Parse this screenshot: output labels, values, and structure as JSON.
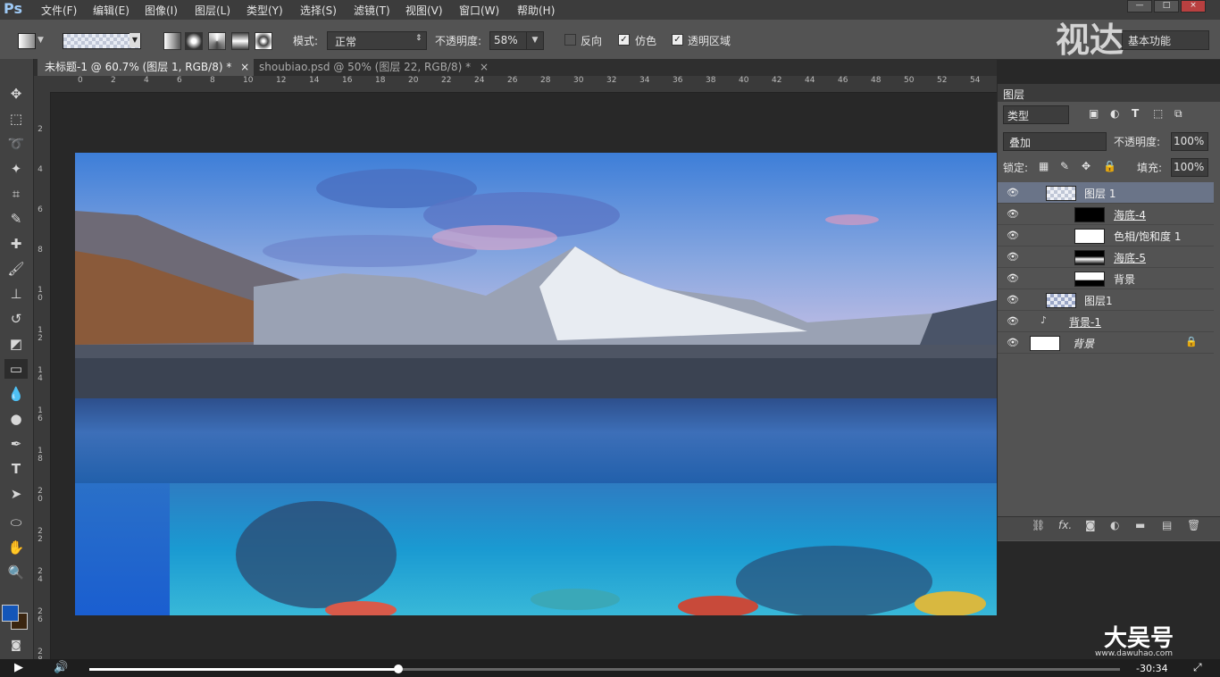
{
  "app": {
    "logo": "Ps"
  },
  "menu": [
    "文件(F)",
    "编辑(E)",
    "图像(I)",
    "图层(L)",
    "类型(Y)",
    "选择(S)",
    "滤镜(T)",
    "视图(V)",
    "窗口(W)",
    "帮助(H)"
  ],
  "window": {
    "minimize": "—",
    "maximize": "□",
    "close": "×"
  },
  "options": {
    "mode_label": "模式:",
    "mode_value": "正常",
    "opacity_label": "不透明度:",
    "opacity_value": "58%",
    "reverse_label": "反向",
    "dither_label": "仿色",
    "transparency_label": "透明区域",
    "workspace": "基本功能"
  },
  "tabs": [
    {
      "label": "未标题-1 @ 60.7% (图层 1, RGB/8) *",
      "close": "×"
    },
    {
      "label": "shoubiao.psd @ 50% (图层 22, RGB/8) *",
      "close": "×"
    }
  ],
  "ruler": {
    "h": [
      "0",
      "2",
      "4",
      "6",
      "8",
      "10",
      "12",
      "14",
      "16",
      "18",
      "20",
      "22",
      "24",
      "26",
      "28",
      "30",
      "32",
      "34",
      "36",
      "38",
      "40",
      "42",
      "44",
      "46",
      "48",
      "50",
      "52",
      "54"
    ],
    "v": [
      "2",
      "4",
      "6",
      "8",
      "1 0",
      "1 2",
      "1 4",
      "1 6",
      "1 8",
      "2 0",
      "2 2",
      "2 4",
      "2 6",
      "2 8"
    ]
  },
  "layers_panel": {
    "title": "图层",
    "filter_label": "类型",
    "blend_mode": "叠加",
    "opacity_label": "不透明度:",
    "opacity_value": "100%",
    "lock_label": "锁定:",
    "fill_label": "填充:",
    "fill_value": "100%",
    "layers": [
      {
        "name": "图层 1",
        "selected": true
      },
      {
        "name": "海底-4",
        "selected": false
      },
      {
        "name": "色相/饱和度 1",
        "selected": false
      },
      {
        "name": "海底-5",
        "selected": false
      },
      {
        "name": "背景",
        "selected": false
      },
      {
        "name": "图层1",
        "selected": false
      },
      {
        "name": "背景-1",
        "selected": false
      },
      {
        "name": "背景",
        "selected": false
      }
    ],
    "footer_fx": "fx."
  },
  "colors": {
    "foreground": "#1456b8",
    "background": "#3a2510",
    "accent": "#6a7488"
  },
  "video": {
    "time": "-30:34",
    "progress": 0.3
  },
  "watermarks": {
    "top": "视达",
    "bottom": "大吴号",
    "bottom_url": "www.dawuhao.com"
  }
}
